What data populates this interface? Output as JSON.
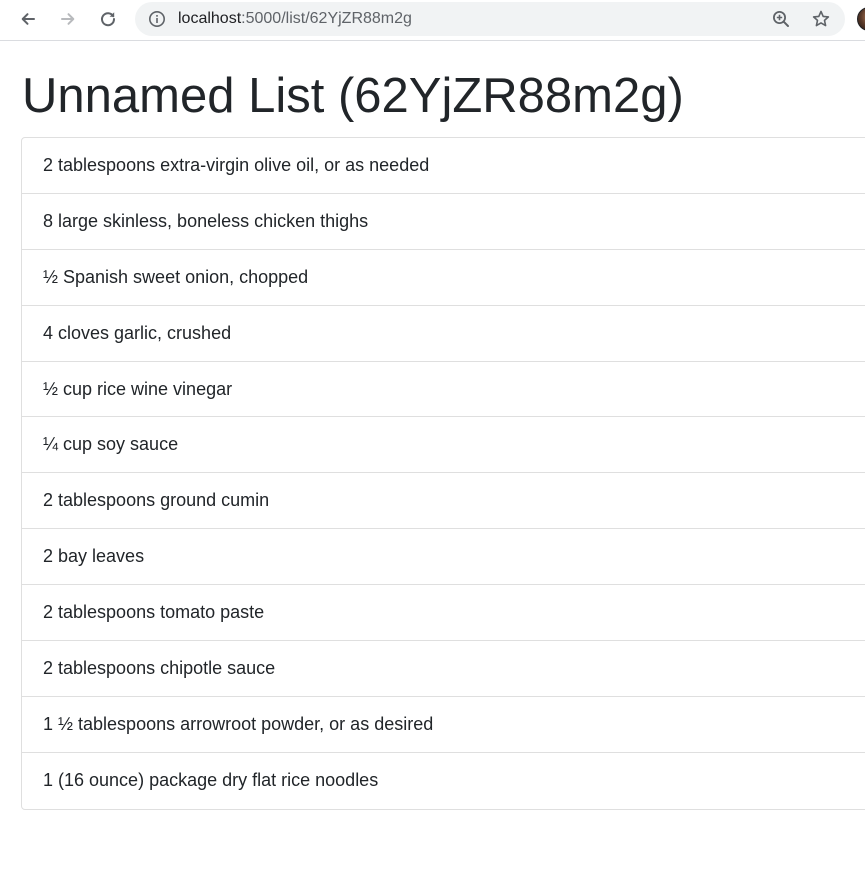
{
  "browser": {
    "url_host": "localhost",
    "url_path": ":5000/list/62YjZR88m2g"
  },
  "page": {
    "title": "Unnamed List (62YjZR88m2g)"
  },
  "list": {
    "items": [
      "2 tablespoons extra-virgin olive oil, or as needed",
      "8 large skinless, boneless chicken thighs",
      "½ Spanish sweet onion, chopped",
      "4 cloves garlic, crushed",
      "½ cup rice wine vinegar",
      "¼ cup soy sauce",
      "2 tablespoons ground cumin",
      "2 bay leaves",
      "2 tablespoons tomato paste",
      "2 tablespoons chipotle sauce",
      "1 ½ tablespoons arrowroot powder, or as desired",
      "1 (16 ounce) package dry flat rice noodles"
    ]
  },
  "icons": {
    "back": "arrow-left-icon",
    "forward": "arrow-right-icon",
    "reload": "reload-icon",
    "info": "info-icon",
    "zoom": "zoom-in-icon",
    "bookmark": "star-icon",
    "profile": "avatar"
  },
  "colors": {
    "text": "#212529",
    "border": "#dfdfdf",
    "omnibox": "#f1f3f4",
    "icon": "#5f6368"
  }
}
